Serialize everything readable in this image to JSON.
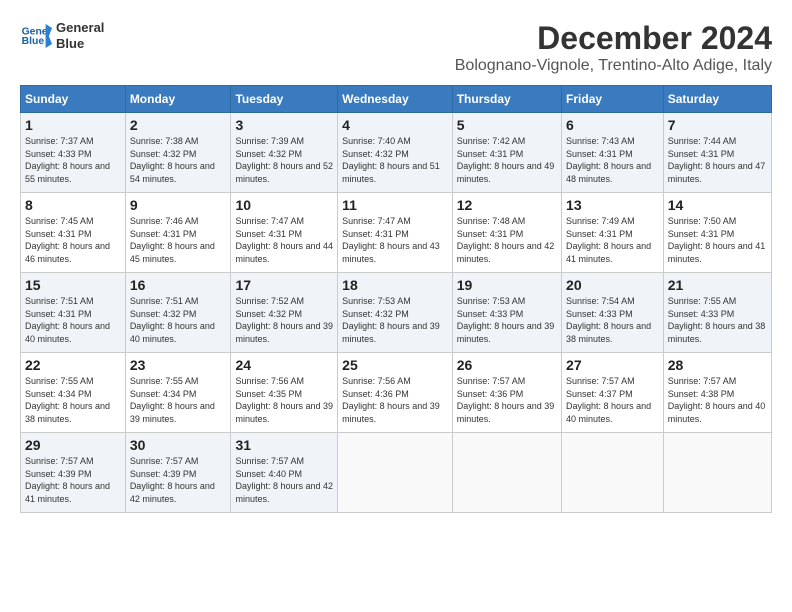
{
  "logo": {
    "line1": "General",
    "line2": "Blue"
  },
  "title": "December 2024",
  "location": "Bolognano-Vignole, Trentino-Alto Adige, Italy",
  "days_of_week": [
    "Sunday",
    "Monday",
    "Tuesday",
    "Wednesday",
    "Thursday",
    "Friday",
    "Saturday"
  ],
  "weeks": [
    [
      {
        "day": "1",
        "sunrise": "7:37 AM",
        "sunset": "4:33 PM",
        "daylight": "8 hours and 55 minutes."
      },
      {
        "day": "2",
        "sunrise": "7:38 AM",
        "sunset": "4:32 PM",
        "daylight": "8 hours and 54 minutes."
      },
      {
        "day": "3",
        "sunrise": "7:39 AM",
        "sunset": "4:32 PM",
        "daylight": "8 hours and 52 minutes."
      },
      {
        "day": "4",
        "sunrise": "7:40 AM",
        "sunset": "4:32 PM",
        "daylight": "8 hours and 51 minutes."
      },
      {
        "day": "5",
        "sunrise": "7:42 AM",
        "sunset": "4:31 PM",
        "daylight": "8 hours and 49 minutes."
      },
      {
        "day": "6",
        "sunrise": "7:43 AM",
        "sunset": "4:31 PM",
        "daylight": "8 hours and 48 minutes."
      },
      {
        "day": "7",
        "sunrise": "7:44 AM",
        "sunset": "4:31 PM",
        "daylight": "8 hours and 47 minutes."
      }
    ],
    [
      {
        "day": "8",
        "sunrise": "7:45 AM",
        "sunset": "4:31 PM",
        "daylight": "8 hours and 46 minutes."
      },
      {
        "day": "9",
        "sunrise": "7:46 AM",
        "sunset": "4:31 PM",
        "daylight": "8 hours and 45 minutes."
      },
      {
        "day": "10",
        "sunrise": "7:47 AM",
        "sunset": "4:31 PM",
        "daylight": "8 hours and 44 minutes."
      },
      {
        "day": "11",
        "sunrise": "7:47 AM",
        "sunset": "4:31 PM",
        "daylight": "8 hours and 43 minutes."
      },
      {
        "day": "12",
        "sunrise": "7:48 AM",
        "sunset": "4:31 PM",
        "daylight": "8 hours and 42 minutes."
      },
      {
        "day": "13",
        "sunrise": "7:49 AM",
        "sunset": "4:31 PM",
        "daylight": "8 hours and 41 minutes."
      },
      {
        "day": "14",
        "sunrise": "7:50 AM",
        "sunset": "4:31 PM",
        "daylight": "8 hours and 41 minutes."
      }
    ],
    [
      {
        "day": "15",
        "sunrise": "7:51 AM",
        "sunset": "4:31 PM",
        "daylight": "8 hours and 40 minutes."
      },
      {
        "day": "16",
        "sunrise": "7:51 AM",
        "sunset": "4:32 PM",
        "daylight": "8 hours and 40 minutes."
      },
      {
        "day": "17",
        "sunrise": "7:52 AM",
        "sunset": "4:32 PM",
        "daylight": "8 hours and 39 minutes."
      },
      {
        "day": "18",
        "sunrise": "7:53 AM",
        "sunset": "4:32 PM",
        "daylight": "8 hours and 39 minutes."
      },
      {
        "day": "19",
        "sunrise": "7:53 AM",
        "sunset": "4:33 PM",
        "daylight": "8 hours and 39 minutes."
      },
      {
        "day": "20",
        "sunrise": "7:54 AM",
        "sunset": "4:33 PM",
        "daylight": "8 hours and 38 minutes."
      },
      {
        "day": "21",
        "sunrise": "7:55 AM",
        "sunset": "4:33 PM",
        "daylight": "8 hours and 38 minutes."
      }
    ],
    [
      {
        "day": "22",
        "sunrise": "7:55 AM",
        "sunset": "4:34 PM",
        "daylight": "8 hours and 38 minutes."
      },
      {
        "day": "23",
        "sunrise": "7:55 AM",
        "sunset": "4:34 PM",
        "daylight": "8 hours and 39 minutes."
      },
      {
        "day": "24",
        "sunrise": "7:56 AM",
        "sunset": "4:35 PM",
        "daylight": "8 hours and 39 minutes."
      },
      {
        "day": "25",
        "sunrise": "7:56 AM",
        "sunset": "4:36 PM",
        "daylight": "8 hours and 39 minutes."
      },
      {
        "day": "26",
        "sunrise": "7:57 AM",
        "sunset": "4:36 PM",
        "daylight": "8 hours and 39 minutes."
      },
      {
        "day": "27",
        "sunrise": "7:57 AM",
        "sunset": "4:37 PM",
        "daylight": "8 hours and 40 minutes."
      },
      {
        "day": "28",
        "sunrise": "7:57 AM",
        "sunset": "4:38 PM",
        "daylight": "8 hours and 40 minutes."
      }
    ],
    [
      {
        "day": "29",
        "sunrise": "7:57 AM",
        "sunset": "4:39 PM",
        "daylight": "8 hours and 41 minutes."
      },
      {
        "day": "30",
        "sunrise": "7:57 AM",
        "sunset": "4:39 PM",
        "daylight": "8 hours and 42 minutes."
      },
      {
        "day": "31",
        "sunrise": "7:57 AM",
        "sunset": "4:40 PM",
        "daylight": "8 hours and 42 minutes."
      },
      null,
      null,
      null,
      null
    ]
  ]
}
